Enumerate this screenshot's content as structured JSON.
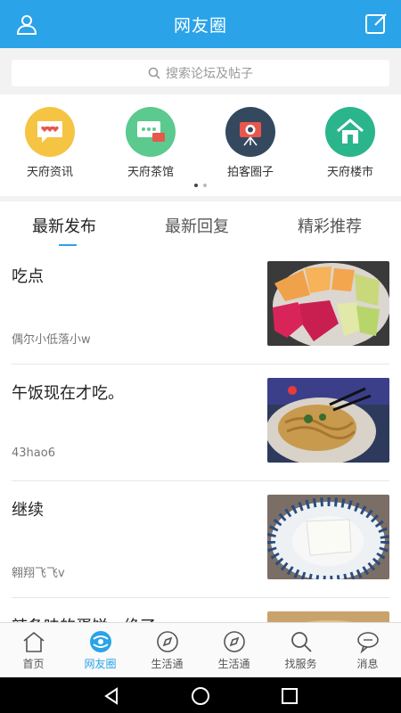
{
  "header": {
    "title": "网友圈"
  },
  "search": {
    "placeholder": "搜索论坛及帖子"
  },
  "categories": [
    {
      "label": "天府资讯",
      "icon": "chat-bubble-icon",
      "color": "#f5c443"
    },
    {
      "label": "天府茶馆",
      "icon": "message-icon",
      "color": "#5cc98f"
    },
    {
      "label": "拍客圈子",
      "icon": "camera-icon",
      "color": "#34495e"
    },
    {
      "label": "天府楼市",
      "icon": "house-icon",
      "color": "#2bb58c"
    }
  ],
  "tabs": [
    {
      "label": "最新发布",
      "active": true
    },
    {
      "label": "最新回复",
      "active": false
    },
    {
      "label": "精彩推荐",
      "active": false
    }
  ],
  "posts": [
    {
      "title": "吃点",
      "author": "偶尔小低落小w"
    },
    {
      "title": "午饭现在才吃。",
      "author": "43hao6"
    },
    {
      "title": "继续",
      "author": "翱翔飞飞v"
    },
    {
      "title": "辣条味的蛋饼，绝了",
      "author": ""
    }
  ],
  "nav": [
    {
      "label": "首页",
      "icon": "home-icon",
      "active": false
    },
    {
      "label": "网友圈",
      "icon": "circle-icon",
      "active": true
    },
    {
      "label": "生活通",
      "icon": "compass-icon",
      "active": false
    },
    {
      "label": "生活通",
      "icon": "compass-icon",
      "active": false
    },
    {
      "label": "找服务",
      "icon": "search-icon",
      "active": false
    },
    {
      "label": "消息",
      "icon": "message-icon",
      "active": false
    }
  ],
  "colors": {
    "accent": "#2aa3e8"
  }
}
